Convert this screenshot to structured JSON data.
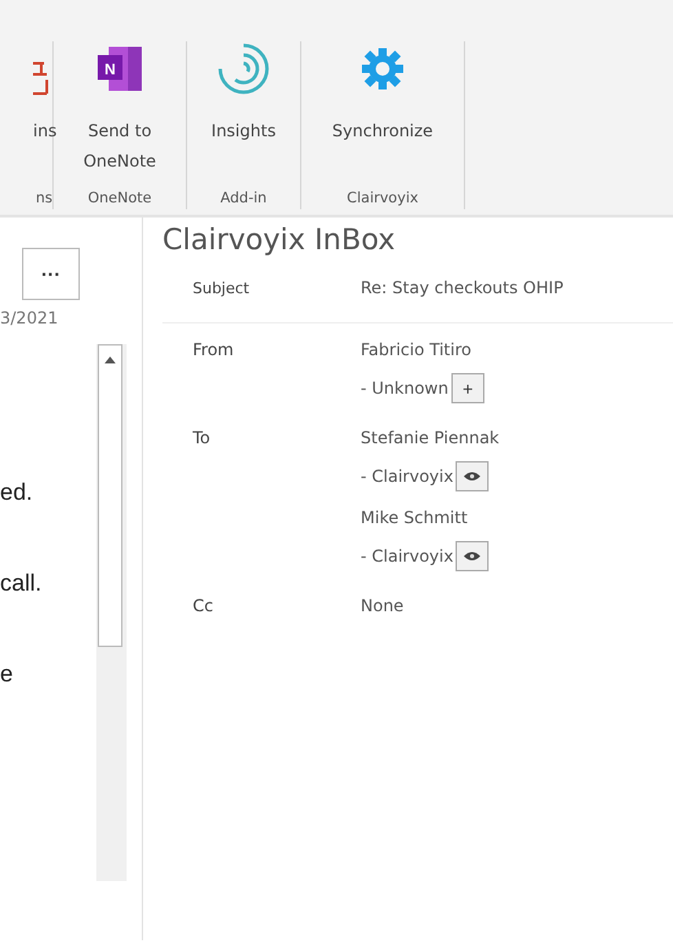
{
  "ribbon": {
    "groups": [
      {
        "kind": "partial",
        "buttons": [
          {
            "label": "ins"
          }
        ],
        "label": "ns"
      },
      {
        "kind": "onenote",
        "buttons": [
          {
            "label": "Send to OneNote",
            "icon_letter": "N"
          }
        ],
        "label": "OneNote"
      },
      {
        "kind": "addin",
        "buttons": [
          {
            "label": "Insights"
          }
        ],
        "label": "Add-in"
      },
      {
        "kind": "clairvoyix",
        "buttons": [
          {
            "label": "Synchronize"
          }
        ],
        "label": "Clairvoyix"
      }
    ]
  },
  "message_pane": {
    "more_button": "···",
    "date": "3/2021",
    "lines": [
      "ed.",
      "call.",
      "e"
    ]
  },
  "inbox": {
    "title": "Clairvoyix InBox",
    "subject": {
      "label": "Subject",
      "value": "Re: Stay checkouts OHIP"
    },
    "fields": [
      {
        "label": "From",
        "recipients": [
          {
            "name": "Fabricio Titiro",
            "status": "- Unknown",
            "kind": "add",
            "button": "+"
          }
        ]
      },
      {
        "label": "To",
        "recipients": [
          {
            "name": "Stefanie Piennak",
            "status": "- Clairvoyix",
            "kind": "view"
          },
          {
            "name": "Mike Schmitt",
            "status": "- Clairvoyix",
            "kind": "view"
          }
        ]
      },
      {
        "label": "Cc",
        "recipients": [
          {
            "name": "None"
          }
        ]
      }
    ]
  }
}
